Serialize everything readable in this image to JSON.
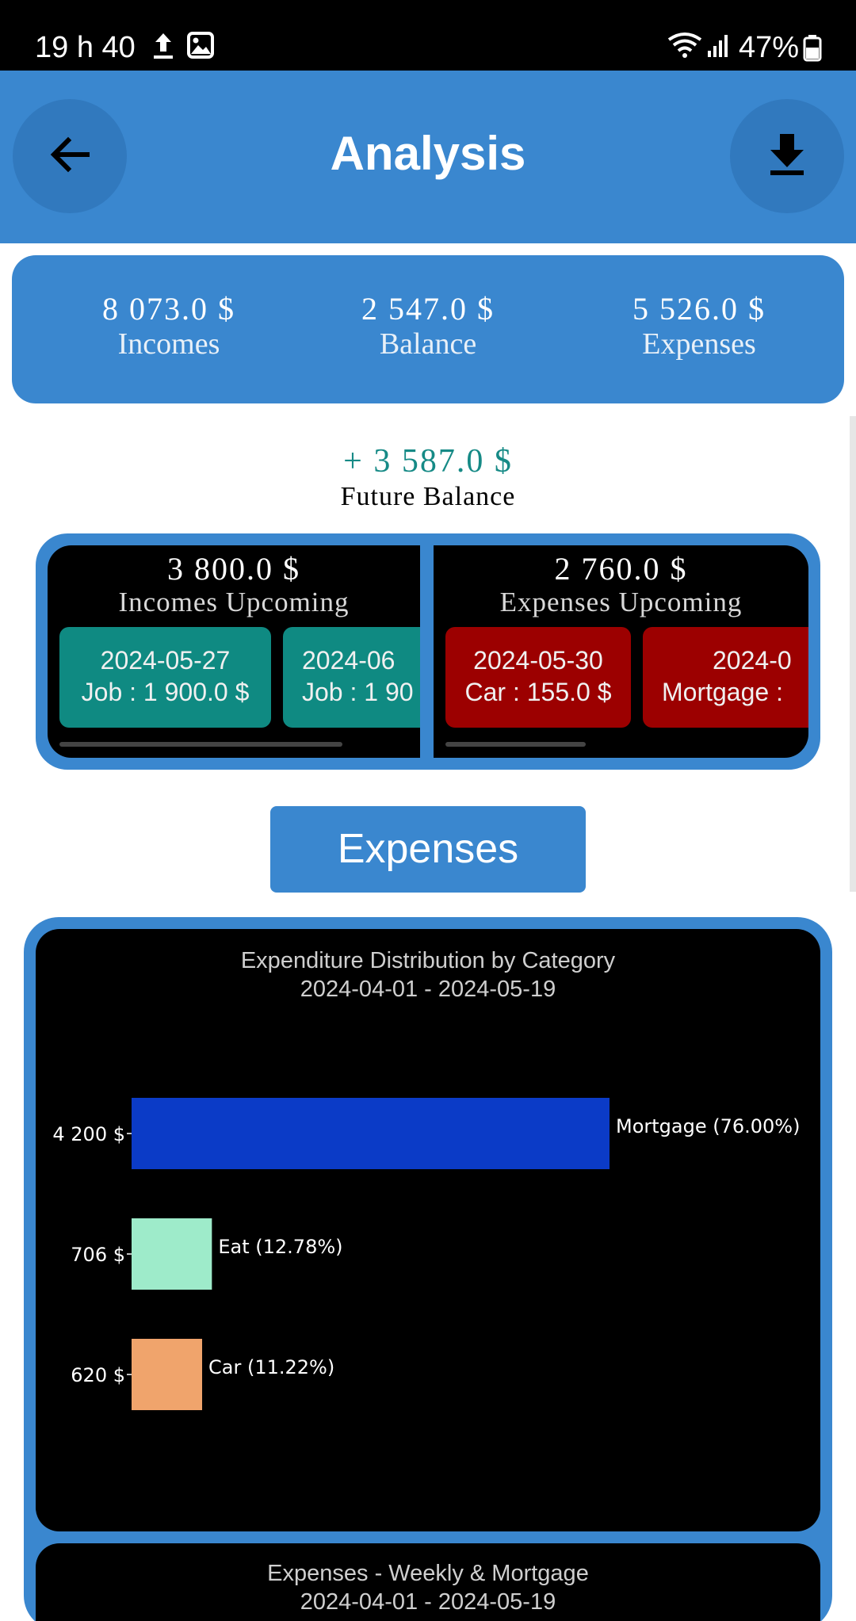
{
  "status_bar": {
    "time": "19 h 40",
    "battery": "47%",
    "icons": [
      "upload-icon",
      "image-icon",
      "wifi-icon",
      "signal-icon",
      "battery-icon"
    ]
  },
  "app_bar": {
    "title": "Analysis",
    "back_icon": "arrow-left-icon",
    "download_icon": "download-icon"
  },
  "summary": {
    "incomes": {
      "amount": "8 073.0 $",
      "label": "Incomes"
    },
    "balance": {
      "amount": "2 547.0 $",
      "label": "Balance"
    },
    "expenses": {
      "amount": "5 526.0 $",
      "label": "Expenses"
    }
  },
  "future_balance": {
    "amount": "+ 3 587.0 $",
    "label": "Future Balance"
  },
  "upcoming": {
    "incomes": {
      "amount": "3 800.0 $",
      "label": "Incomes Upcoming",
      "items": [
        {
          "date": "2024-05-27",
          "text": "Job : 1 900.0 $"
        },
        {
          "date": "2024-06",
          "text": "Job : 1 90"
        }
      ]
    },
    "expenses": {
      "amount": "2 760.0 $",
      "label": "Expenses Upcoming",
      "items": [
        {
          "date": "2024-05-30",
          "text": "Car : 155.0 $"
        },
        {
          "date": "2024-0",
          "text": "Mortgage : "
        }
      ]
    }
  },
  "section_button": "Expenses",
  "colors": {
    "accent": "#3a87cf",
    "teal": "#0f8a82",
    "red": "#9c0000"
  },
  "chart_data": [
    {
      "type": "bar",
      "orientation": "horizontal",
      "title": "Expenditure Distribution by Category",
      "subtitle": "2024-04-01 - 2024-05-19",
      "categories": [
        "Mortgage (76.00%)",
        "Eat (12.78%)",
        "Car (11.22%)"
      ],
      "values": [
        4200,
        706,
        620
      ],
      "value_labels": [
        "4 200 $",
        "706 $",
        "620 $"
      ],
      "colors": [
        "#0b3bc7",
        "#9eebca",
        "#f0a46c"
      ],
      "xlim": [
        0,
        4200
      ]
    },
    {
      "type": "bar",
      "title": "Expenses - Weekly & Mortgage",
      "subtitle": "2024-04-01 - 2024-05-19"
    }
  ]
}
